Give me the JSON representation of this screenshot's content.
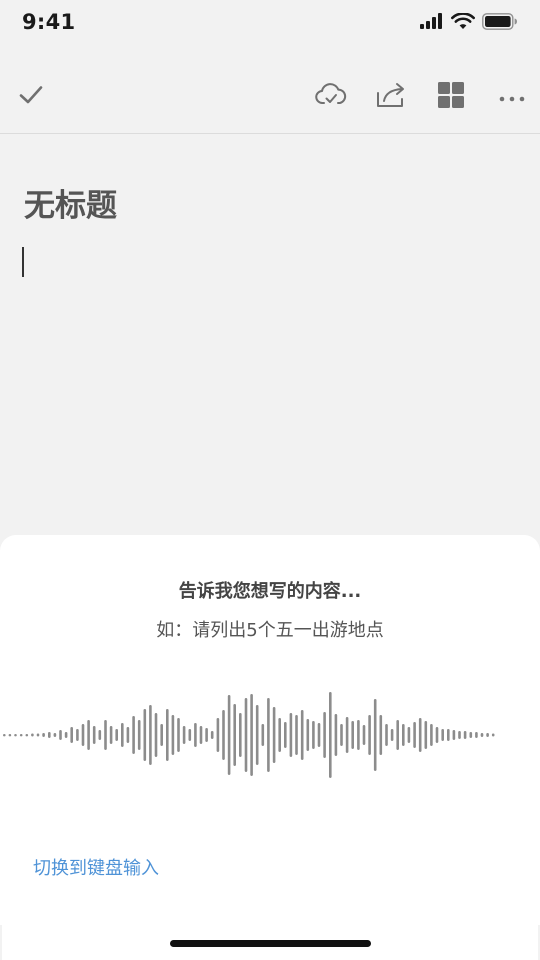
{
  "status_bar": {
    "time": "9:41",
    "icons": [
      "cellular-signal-icon",
      "wifi-icon",
      "battery-icon"
    ]
  },
  "toolbar": {
    "left_icon": "checkmark-icon",
    "right_icons": [
      "cloud-sync-icon",
      "share-icon",
      "grid-view-icon",
      "more-icon"
    ]
  },
  "note": {
    "title": "无标题"
  },
  "voice_input": {
    "prompt": "告诉我您想写的内容...",
    "example": "如：请列出5个五一出游地点",
    "switch_label": "切换到键盘输入"
  },
  "colors": {
    "background": "#f2f2f2",
    "sheet": "#ffffff",
    "link": "#4f93d7",
    "icon": "#707070",
    "waveform": "#8c8c8c"
  }
}
